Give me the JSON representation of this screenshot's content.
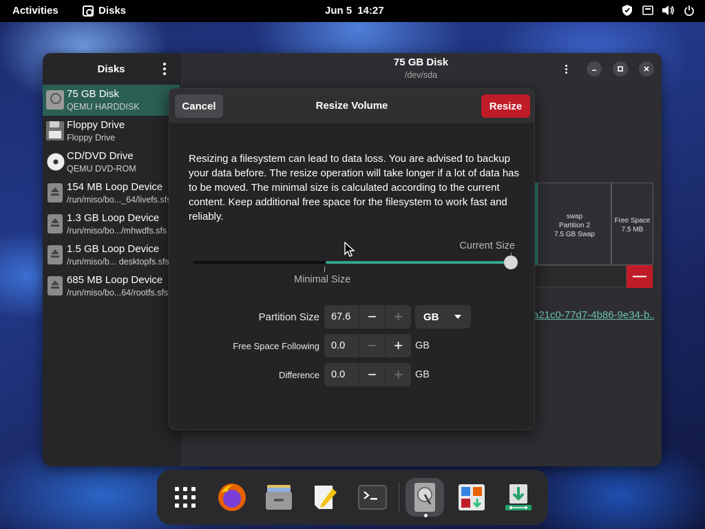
{
  "topbar": {
    "activities": "Activities",
    "app_name": "Disks",
    "date": "Jun 5",
    "time": "14:27",
    "tray_icons": [
      "shield-icon",
      "network-icon",
      "volume-icon",
      "power-icon"
    ]
  },
  "sidebar": {
    "title": "Disks",
    "items": [
      {
        "name": "75 GB Disk",
        "sub": "QEMU HARDDISK",
        "icon": "hard-disk-icon",
        "selected": true
      },
      {
        "name": "Floppy Drive",
        "sub": "Floppy Drive",
        "icon": "floppy-icon"
      },
      {
        "name": "CD/DVD Drive",
        "sub": "QEMU DVD-ROM",
        "icon": "optical-disc-icon"
      },
      {
        "name": "154 MB Loop Device",
        "sub": "/run/miso/bo..._64/livefs.sfs",
        "icon": "loop-device-icon"
      },
      {
        "name": "1.3 GB Loop Device",
        "sub": "/run/miso/bo.../mhwdfs.sfs",
        "icon": "loop-device-icon"
      },
      {
        "name": "1.5 GB Loop Device",
        "sub": "/run/miso/b... desktopfs.sfs",
        "icon": "loop-device-icon"
      },
      {
        "name": "685 MB Loop Device",
        "sub": "/run/miso/bo...64/rootfs.sfs",
        "icon": "loop-device-icon"
      }
    ]
  },
  "main": {
    "title": "75 GB Disk",
    "subtitle": "/dev/sda",
    "partitions": [
      {
        "line1": "swap",
        "line2": "Partition 2",
        "line3": "7.5 GB Swap"
      },
      {
        "line1": "Free Space",
        "line2": "7.5 MB"
      }
    ],
    "minus_symbol": "—",
    "uuid_fragment": "a21c0-77d7-4b86-9e34-b..."
  },
  "dialog": {
    "cancel_label": "Cancel",
    "title": "Resize Volume",
    "resize_label": "Resize",
    "description": "Resizing a filesystem can lead to data loss. You are advised to backup your data before. The resize operation will take longer if a lot of data has to be moved. The minimal size is calculated according to the current content. Keep additional free space for the filesystem to work fast and reliably.",
    "slider": {
      "current_label": "Current Size",
      "minimal_label": "Minimal Size",
      "minimal_fraction": 0.415,
      "value_fraction": 1.0
    },
    "partition_size": {
      "label": "Partition Size",
      "value": "67.6"
    },
    "unit_selected": "GB",
    "free_space_following": {
      "label": "Free Space Following",
      "value": "0.0",
      "unit": "GB"
    },
    "difference": {
      "label": "Difference",
      "value": "0.0",
      "unit": "GB"
    },
    "minus": "−",
    "plus": "+"
  },
  "dock": {
    "items": [
      "app-grid-icon",
      "firefox-icon",
      "file-manager-icon",
      "text-editor-icon",
      "terminal-icon",
      "disks-icon",
      "software-center-icon",
      "installer-icon"
    ],
    "accent": "#c01c28",
    "selection": "#2b5f53",
    "slider_fill": "#33a28a"
  }
}
